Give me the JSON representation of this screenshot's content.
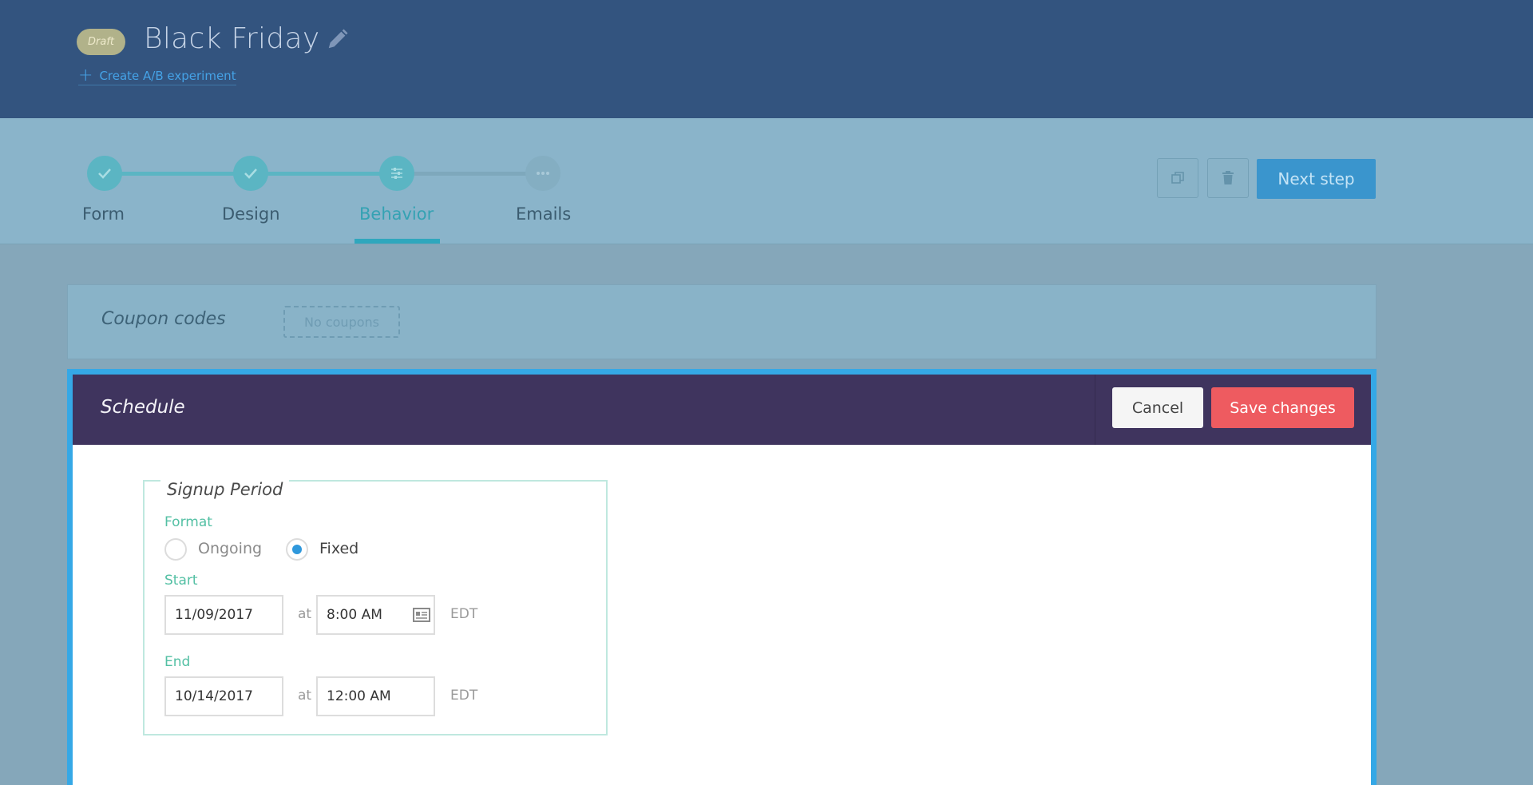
{
  "header": {
    "status_badge": "Draft",
    "title": "Black Friday",
    "ab_link": "Create A/B experiment"
  },
  "steps": {
    "items": [
      {
        "label": "Form",
        "state": "done"
      },
      {
        "label": "Design",
        "state": "done"
      },
      {
        "label": "Behavior",
        "state": "active"
      },
      {
        "label": "Emails",
        "state": "todo"
      }
    ],
    "next_button": "Next step"
  },
  "coupon": {
    "label": "Coupon codes",
    "value": "No coupons"
  },
  "schedule": {
    "title": "Schedule",
    "cancel": "Cancel",
    "save": "Save changes",
    "signup": {
      "legend": "Signup Period",
      "format_label": "Format",
      "options": [
        "Ongoing",
        "Fixed"
      ],
      "selected": "Fixed",
      "start_label": "Start",
      "start_date": "11/09/2017",
      "start_time": "8:00 AM",
      "end_label": "End",
      "end_date": "10/14/2017",
      "end_time": "12:00 AM",
      "at": "at",
      "timezone": "EDT"
    }
  },
  "colors": {
    "header_bg": "#33547f",
    "accent_teal": "#5bb5c3",
    "primary_blue": "#3a95cd",
    "save_red": "#ee5b60",
    "schedule_header": "#3f345e",
    "focus_border": "#35a8e6",
    "label_green": "#54c0a4"
  },
  "icons": [
    "pencil-icon",
    "plus-icon",
    "check-icon",
    "sliders-icon",
    "ellipsis-icon",
    "duplicate-icon",
    "trash-icon",
    "calendar-icon"
  ]
}
